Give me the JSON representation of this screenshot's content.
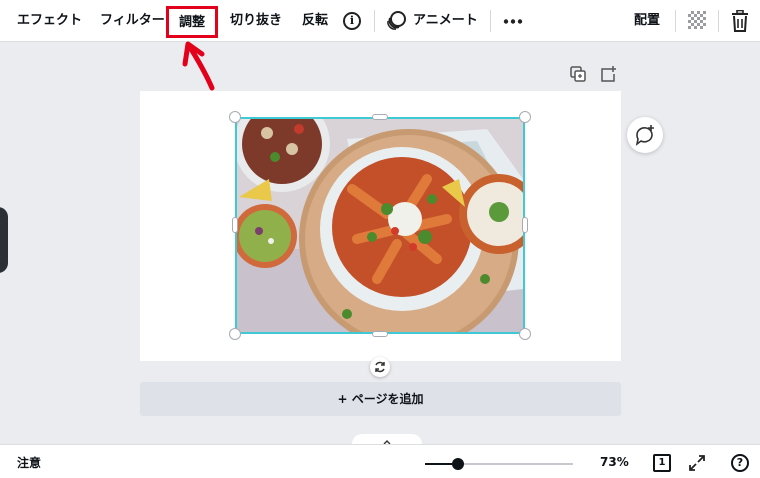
{
  "toolbar": {
    "effects": "エフェクト",
    "filters": "フィルター",
    "adjust": "調整",
    "crop": "切り抜き",
    "flip": "反転",
    "animate": "アニメート",
    "position": "配置",
    "info_icon": "info-icon",
    "transparency_icon": "checkerboard-icon",
    "delete_icon": "trash-icon",
    "more_icon": "more-icon"
  },
  "annotation": {
    "highlight_color": "#e3001b",
    "arrow_color": "#e3001b"
  },
  "canvas": {
    "add_page_label": "+ ページを追加",
    "selection_color": "#3fc9d4"
  },
  "footer": {
    "notes_label": "注意",
    "zoom_percent": "73%",
    "zoom_fraction": 0.22,
    "page_count": "1"
  }
}
